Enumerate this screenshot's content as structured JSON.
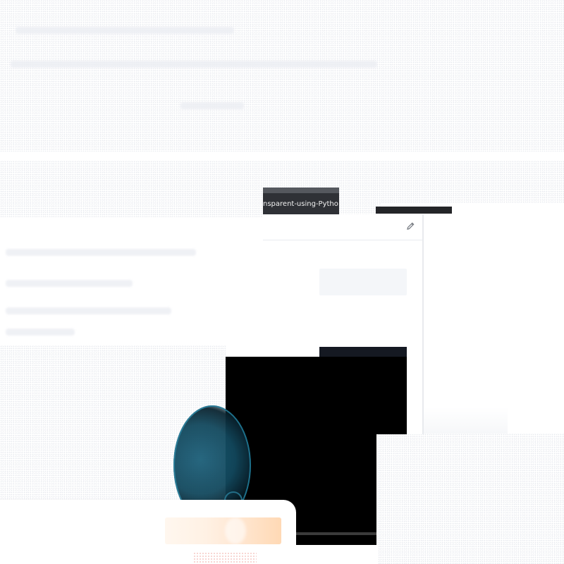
{
  "browser": {
    "tab_label": "nsparent-using-Pytho"
  },
  "editor": {
    "icon": "pencil-icon"
  },
  "preview": {
    "background": "#000000",
    "accent": "#1f7693"
  }
}
